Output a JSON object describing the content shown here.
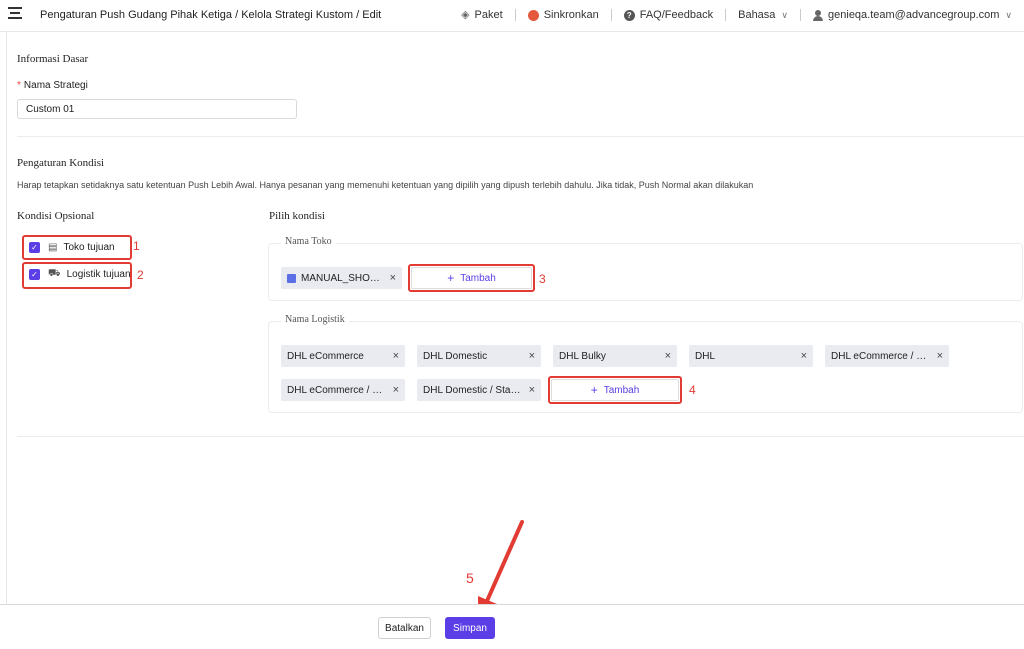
{
  "header": {
    "breadcrumb": "Pengaturan Push Gudang Pihak Ketiga / Kelola Strategi Kustom / Edit",
    "paket": "Paket",
    "sinkronkan": "Sinkronkan",
    "faq": "FAQ/Feedback",
    "bahasa": "Bahasa",
    "user_email": "genieqa.team@advancegroup.com"
  },
  "basic": {
    "section_title": "Informasi Dasar",
    "name_label": "Nama Strategi",
    "name_value": "Custom 01"
  },
  "conditions": {
    "section_title": "Pengaturan Kondisi",
    "helper": "Harap tetapkan setidaknya satu ketentuan Push Lebih Awal. Hanya pesanan yang memenuhi ketentuan yang dipilih yang dipush terlebih dahulu. Jika tidak, Push Normal akan dilakukan",
    "optional_title": "Kondisi Opsional",
    "choose_title": "Pilih kondisi",
    "options": [
      {
        "label": "Toko tujuan",
        "checked": true
      },
      {
        "label": "Logistik tujuan",
        "checked": true
      }
    ],
    "shop_group": {
      "legend": "Nama Toko",
      "tags": [
        "MANUAL_SHOP (ID)"
      ],
      "add_label": "Tambah"
    },
    "logistics_group": {
      "legend": "Nama Logistik",
      "tags": [
        "DHL eCommerce",
        "DHL Domestic",
        "DHL Bulky",
        "DHL",
        "DHL eCommerce / DHL eCommerce Standard",
        "DHL eCommerce / Standard",
        "DHL Domestic / Standard"
      ],
      "add_label": "Tambah"
    }
  },
  "footer": {
    "cancel_label": "Batalkan",
    "save_label": "Simpan"
  },
  "annotations": [
    "1",
    "2",
    "3",
    "4",
    "5"
  ],
  "colors": {
    "accent": "#5b3ee6",
    "annotation": "#e23b33"
  },
  "icons": [
    "menu-icon",
    "diamond-icon",
    "sync-icon",
    "help-icon",
    "user-icon",
    "chevron-down-icon",
    "store-icon",
    "truck-icon",
    "close-icon",
    "plus-icon"
  ]
}
